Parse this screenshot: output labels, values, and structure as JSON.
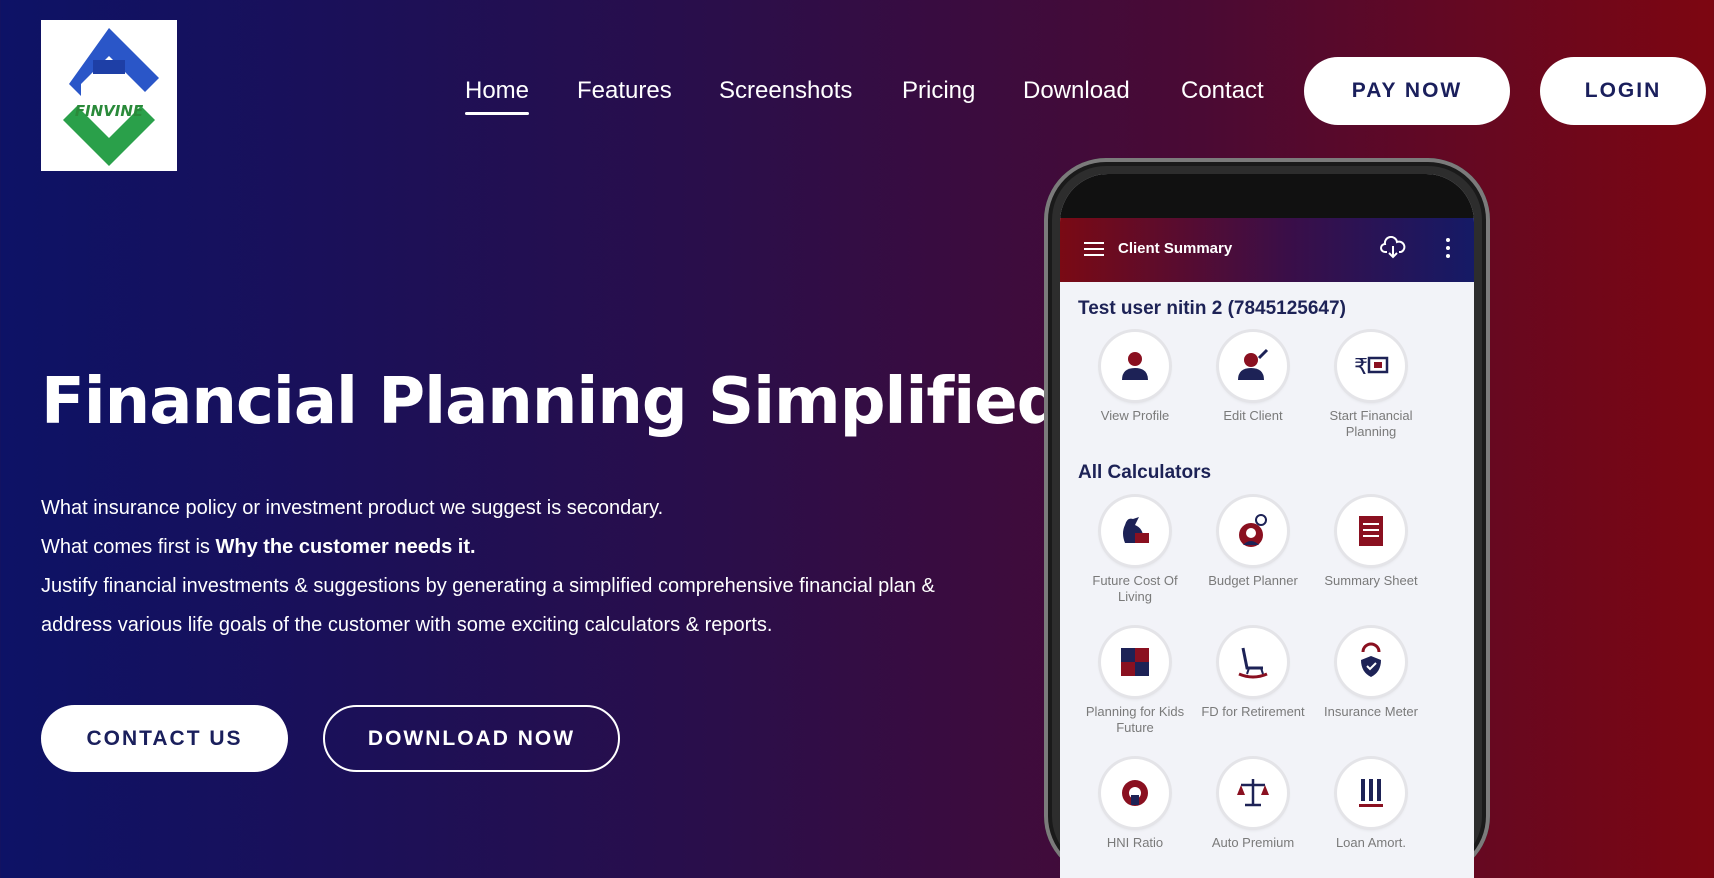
{
  "logo": {
    "text": "FINVINE"
  },
  "nav": {
    "items": [
      "Home",
      "Features",
      "Screenshots",
      "Pricing",
      "Download",
      "Contact"
    ],
    "active": "Home",
    "pay_label": "PAY NOW",
    "login_label": "LOGIN"
  },
  "hero": {
    "title": "Financial Planning Simplified",
    "line1": "What insurance policy or investment product we suggest is secondary.",
    "line2_prefix": "What comes first is ",
    "line2_bold": "Why the customer needs it.",
    "line3": "Justify financial investments & suggestions by generating a simplified comprehensive financial plan &",
    "line4": "address various life goals of the customer with some exciting calculators & reports.",
    "contact_label": "CONTACT US",
    "download_label": "DOWNLOAD NOW"
  },
  "phone": {
    "appbar_title": "Client Summary",
    "client_name": "Test user nitin 2 (7845125647)",
    "client_actions": [
      {
        "label": "View Profile",
        "icon": "user-icon"
      },
      {
        "label": "Edit Client",
        "icon": "edit-user-icon"
      },
      {
        "label": "Start Financial Planning",
        "icon": "rupee-cash-icon"
      }
    ],
    "calculators_title": "All Calculators",
    "calculators": [
      {
        "label": "Future Cost Of Living",
        "icon": "money-bag-icon"
      },
      {
        "label": "Budget Planner",
        "icon": "budget-icon"
      },
      {
        "label": "Summary Sheet",
        "icon": "summary-sheet-icon"
      },
      {
        "label": "Planning for Kids Future",
        "icon": "puzzle-icon"
      },
      {
        "label": "FD for Retirement",
        "icon": "rocking-chair-icon"
      },
      {
        "label": "Insurance Meter",
        "icon": "shield-meter-icon"
      },
      {
        "label": "HNI Ratio",
        "icon": "hni-ratio-icon"
      },
      {
        "label": "Auto Premium",
        "icon": "scale-icon"
      },
      {
        "label": "Loan Amort.",
        "icon": "loan-bars-icon"
      }
    ]
  },
  "colors": {
    "navy": "#1d2256",
    "bg_left": "#0d1266",
    "bg_right": "#7d0611",
    "icon_red": "#8a1020"
  }
}
